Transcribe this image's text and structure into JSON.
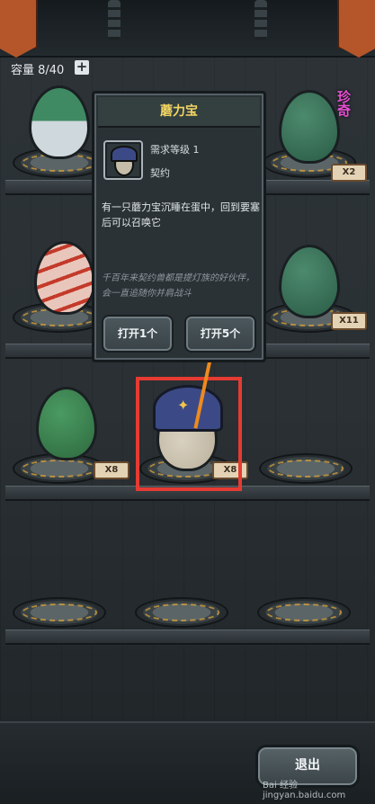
{
  "header": {
    "capacity_label": "容量 8/40",
    "plus_icon": "+"
  },
  "rare_badge": "珍奇",
  "egg_counts": {
    "top_right": "X2",
    "mid_right": "X11",
    "lower_left": "X8",
    "center": "X8"
  },
  "popup": {
    "title": "蘑力宝",
    "requirement": "需求等级 1",
    "type": "契约",
    "description": "有一只蘑力宝沉睡在蛋中，回到要塞后可以召唤它",
    "lore": "千百年来契约兽都是提灯族的好伙伴，会一直追随你并肩战斗",
    "open_one": "打开1个",
    "open_five": "打开5个"
  },
  "footer": {
    "back_button": "退出",
    "watermark": "Bai 经验 jingyan.baidu.com"
  },
  "colors": {
    "accent_gold": "#f3d562",
    "highlight_red": "#e53b32",
    "arrow_orange": "#ef8a1e",
    "rare_pink": "#e64fd2"
  }
}
